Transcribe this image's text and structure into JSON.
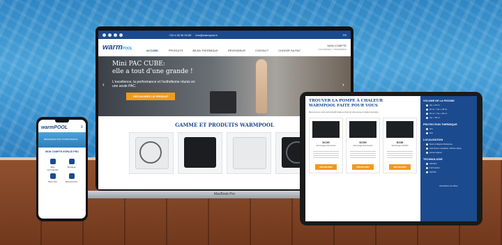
{
  "laptop": {
    "topbar": {
      "phone": "+33 4 28 30 00 89",
      "email": "info@warmpool.fr",
      "lang": "FR"
    },
    "logo": {
      "main": "warm",
      "accent": "POOL"
    },
    "account": {
      "label": "MON COMPTE",
      "sub": "Connexion / Inscription"
    },
    "menu": [
      "ACCUEIL",
      "PRODUITS",
      "BILAN THERMIQUE",
      "REVENDEUR",
      "CONTACT",
      "CHOISIR SA PAC"
    ],
    "hero": {
      "title_line1": "Mini PAC CUBE:",
      "title_line2": "elle a tout d'une grande !",
      "text": "L'excellence, la performance et l'esthétisme réunis en une seule PAC.",
      "cta": "DÉCOUVREZ LE PRODUIT",
      "prev": "‹",
      "next": "›"
    },
    "section_title": "GAMME ET PRODUITS WARMPOOL",
    "brand": "MacBook Pro"
  },
  "phone": {
    "logo": "warmPOOL",
    "hero_text": "BIENVENUE SUR VOTRE ESPACE",
    "title": "MON COMPTE ESPACE PRO",
    "tiles": [
      "Mes commandes",
      "Boutique",
      "Mes infos",
      "Déconnexion"
    ]
  },
  "tablet": {
    "title_line1": "TROUVER LA POMPE À CHALEUR",
    "title_line2": "WARMPOOL FAITE POUR VOUS",
    "intro": "Bienvenue sur notre outil interactif d'aide au choix de votre pompe à chaleur de piscine.",
    "cards": [
      {
        "name": "DC35",
        "sub": "Technologie Full Inverter",
        "cta": "DÉCOUVRIR"
      },
      {
        "name": "DC55",
        "sub": "Technologie Full Inverter",
        "cta": "DÉCOUVRIR"
      },
      {
        "name": "EZ35",
        "sub": "Technologie ON/OFF",
        "cta": "DÉCOUVRIR"
      }
    ],
    "filters": [
      {
        "heading": "VOLUME DE LA PISCINE",
        "options": [
          "Vol. ≤ 25 m³",
          "25 m³ < Vol. ≤ 45 m³",
          "45 m³ < Vol. ≤ 65 m³",
          "Vol. > 65 m³"
        ]
      },
      {
        "heading": "PROTECTION THERMIQUE",
        "options": [
          "Oui",
          "Non"
        ]
      },
      {
        "heading": "LOCALISATION",
        "options": [
          "Nord et Région Parisienne",
          "Sud-Ouest / Aquitaine / Rhône-Alpes",
          "autres régions"
        ]
      },
      {
        "heading": "TECHNOLOGIE",
        "options": [
          "ON/OFF",
          "Full Inverter",
          "Hybride"
        ]
      }
    ],
    "reset": "Réinitialiser les filtres"
  }
}
